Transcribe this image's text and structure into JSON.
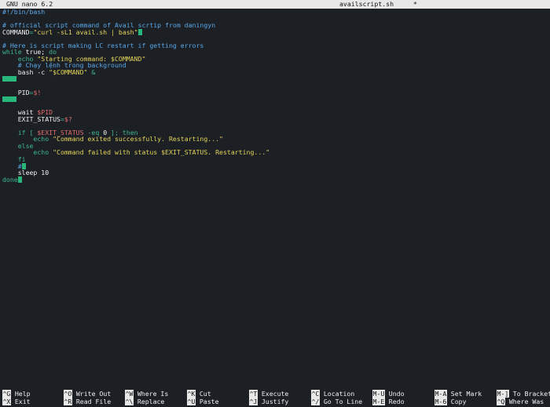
{
  "titlebar": {
    "app": "GNU nano 6.2",
    "file": "availscript.sh",
    "modified": "*"
  },
  "code": [
    {
      "parts": [
        {
          "t": "#!/bin/bash",
          "c": "c-comment"
        }
      ]
    },
    {
      "parts": []
    },
    {
      "parts": [
        {
          "t": "# official script command of Avail scrtip from daningyn",
          "c": "c-comment"
        }
      ]
    },
    {
      "parts": [
        {
          "t": "COMMAND",
          "c": "c-plain"
        },
        {
          "t": "=",
          "c": "c-kw"
        },
        {
          "t": "\"curl -sL1 avail.sh | bash\"",
          "c": "c-str"
        }
      ],
      "cursor": true
    },
    {
      "parts": []
    },
    {
      "parts": [
        {
          "t": "# Here is script making LC restart if getting errors",
          "c": "c-comment"
        }
      ]
    },
    {
      "parts": [
        {
          "t": "while",
          "c": "c-kw"
        },
        {
          "t": " true; ",
          "c": "c-plain"
        },
        {
          "t": "do",
          "c": "c-kw"
        }
      ]
    },
    {
      "parts": [
        {
          "t": "    echo ",
          "c": "c-kw"
        },
        {
          "t": "\"Starting command: $COMMAND\"",
          "c": "c-str"
        }
      ]
    },
    {
      "parts": [
        {
          "t": "    # Chạy lệnh trong background",
          "c": "c-comment"
        }
      ]
    },
    {
      "parts": [
        {
          "t": "    bash -c ",
          "c": "c-plain"
        },
        {
          "t": "\"$COMMAND\"",
          "c": "c-str"
        },
        {
          "t": " &",
          "c": "c-kw"
        }
      ]
    },
    {
      "parts": [],
      "block": true
    },
    {
      "parts": []
    },
    {
      "parts": [
        {
          "t": "    PID",
          "c": "c-plain"
        },
        {
          "t": "=",
          "c": "c-kw"
        },
        {
          "t": "$!",
          "c": "c-var"
        }
      ]
    },
    {
      "parts": [],
      "block": true
    },
    {
      "parts": []
    },
    {
      "parts": [
        {
          "t": "    wait ",
          "c": "c-plain"
        },
        {
          "t": "$PID",
          "c": "c-var"
        }
      ]
    },
    {
      "parts": [
        {
          "t": "    EXIT_STATUS",
          "c": "c-plain"
        },
        {
          "t": "=",
          "c": "c-kw"
        },
        {
          "t": "$?",
          "c": "c-var"
        }
      ]
    },
    {
      "parts": []
    },
    {
      "parts": [
        {
          "t": "    if [ ",
          "c": "c-kw"
        },
        {
          "t": "$EXIT_STATUS",
          "c": "c-var"
        },
        {
          "t": " -eq ",
          "c": "c-kw"
        },
        {
          "t": "0",
          "c": "c-plain"
        },
        {
          "t": " ]; then",
          "c": "c-kw"
        }
      ]
    },
    {
      "parts": [
        {
          "t": "        echo ",
          "c": "c-kw"
        },
        {
          "t": "\"Command exited successfully. Restarting...\"",
          "c": "c-str"
        }
      ]
    },
    {
      "parts": [
        {
          "t": "    else",
          "c": "c-kw"
        }
      ]
    },
    {
      "parts": [
        {
          "t": "        echo ",
          "c": "c-kw"
        },
        {
          "t": "\"Command failed with status $EXIT_STATUS. Restarting...\"",
          "c": "c-str"
        }
      ]
    },
    {
      "parts": [
        {
          "t": "    fi",
          "c": "c-kw"
        }
      ]
    },
    {
      "parts": [
        {
          "t": "    #",
          "c": "c-comment"
        }
      ],
      "cursor": true
    },
    {
      "parts": [
        {
          "t": "    sleep 10",
          "c": "c-plain"
        }
      ]
    },
    {
      "parts": [
        {
          "t": "done",
          "c": "c-kw"
        }
      ],
      "cursor": true
    }
  ],
  "shortcuts": [
    {
      "key": "^G",
      "label": "Help"
    },
    {
      "key": "^X",
      "label": "Exit"
    },
    {
      "key": "^O",
      "label": "Write Out"
    },
    {
      "key": "^R",
      "label": "Read File"
    },
    {
      "key": "^W",
      "label": "Where Is"
    },
    {
      "key": "^\\",
      "label": "Replace"
    },
    {
      "key": "^K",
      "label": "Cut"
    },
    {
      "key": "^U",
      "label": "Paste"
    },
    {
      "key": "^T",
      "label": "Execute"
    },
    {
      "key": "^J",
      "label": "Justify"
    },
    {
      "key": "^C",
      "label": "Location"
    },
    {
      "key": "^/",
      "label": "Go To Line"
    },
    {
      "key": "M-U",
      "label": "Undo"
    },
    {
      "key": "M-E",
      "label": "Redo"
    },
    {
      "key": "M-A",
      "label": "Set Mark"
    },
    {
      "key": "M-6",
      "label": "Copy"
    },
    {
      "key": "M-]",
      "label": "To Bracket"
    },
    {
      "key": "^Q",
      "label": "Where Was"
    }
  ]
}
